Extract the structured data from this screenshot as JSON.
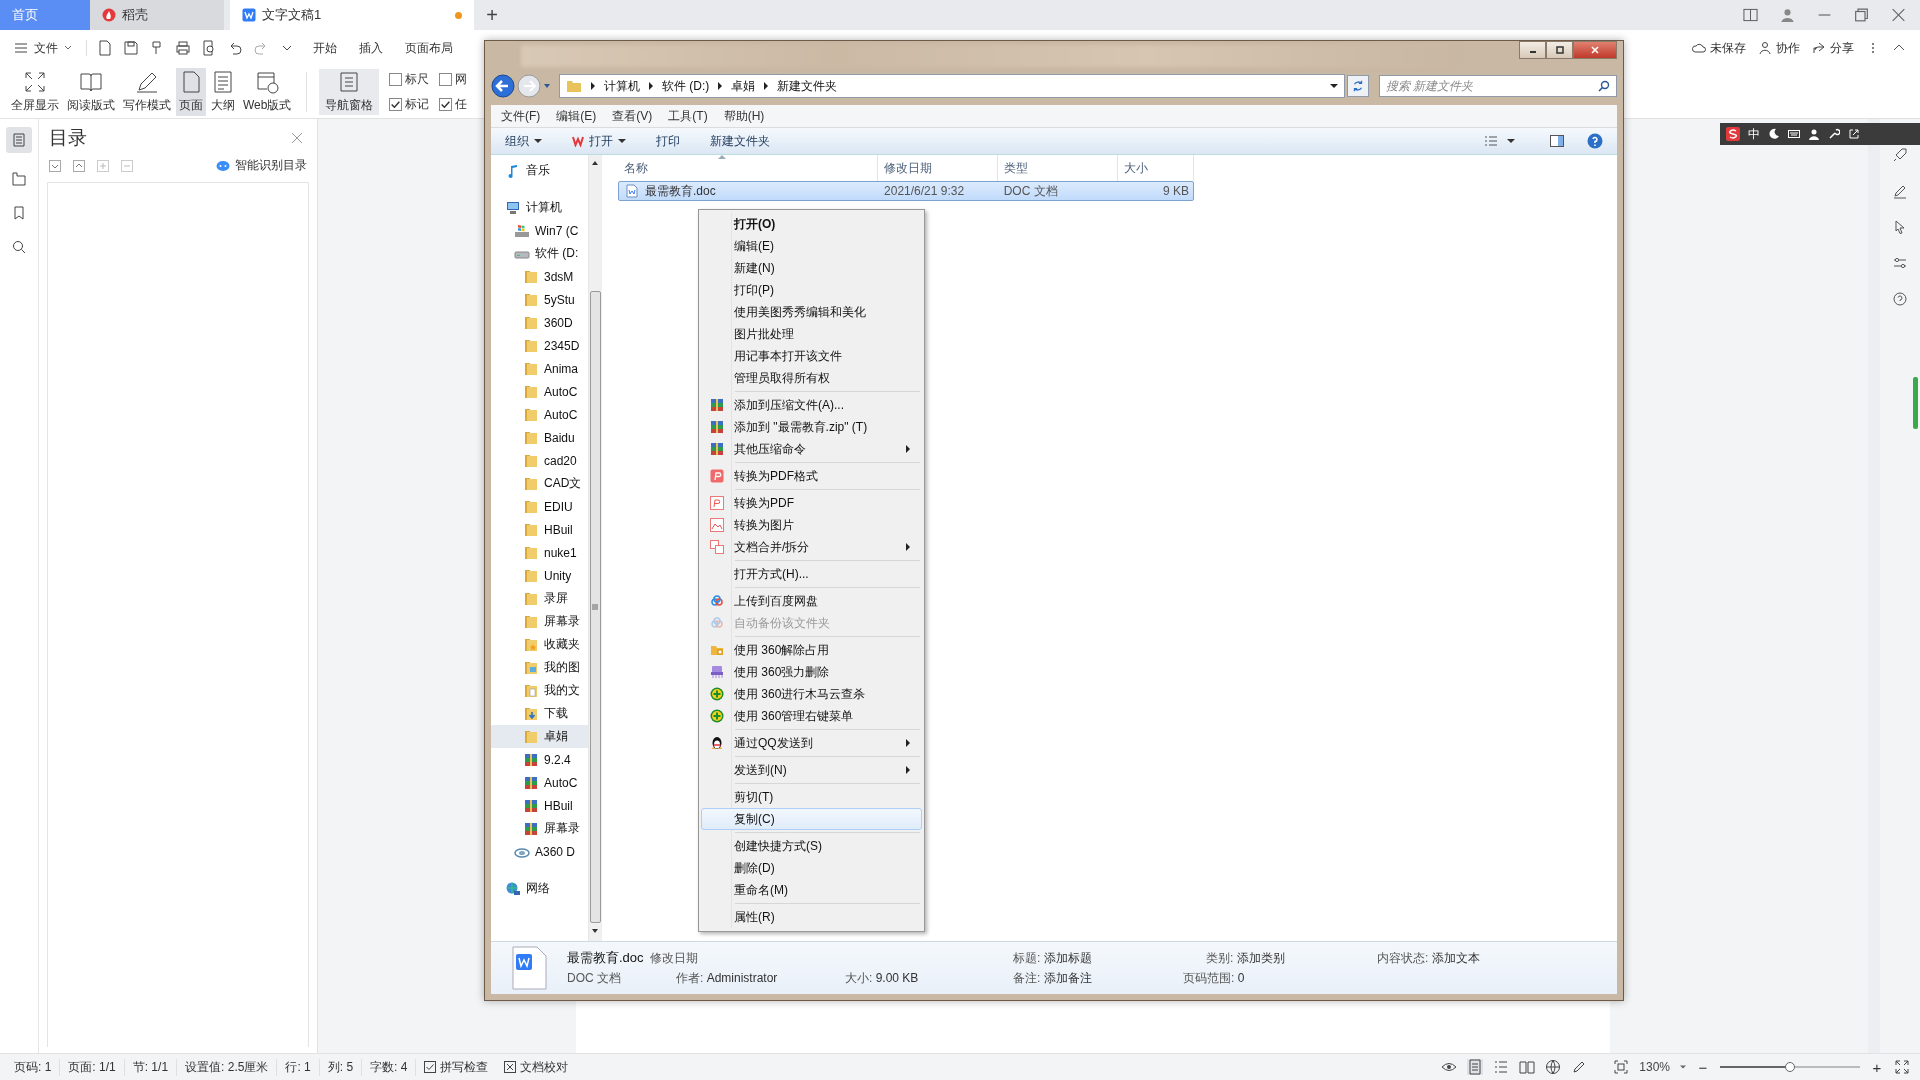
{
  "tabs": [
    {
      "label": "首页",
      "kind": "home",
      "selected": false,
      "unsaved": false
    },
    {
      "label": "稻壳",
      "kind": "docer",
      "selected": false,
      "unsaved": false
    },
    {
      "label": "文字文稿1",
      "kind": "doc",
      "selected": true,
      "unsaved": true
    }
  ],
  "new_tab": "+",
  "file_menu": "文件",
  "menu_tabs": [
    "开始",
    "插入",
    "页面布局"
  ],
  "ribbon": [
    {
      "label": "全屏显示",
      "kind": "fullscreen",
      "selected": false
    },
    {
      "label": "阅读版式",
      "kind": "read",
      "selected": false
    },
    {
      "label": "写作模式",
      "kind": "write",
      "selected": false
    },
    {
      "label": "页面",
      "kind": "page",
      "selected": true
    },
    {
      "label": "大纲",
      "kind": "outline",
      "selected": false
    },
    {
      "label": "Web版式",
      "kind": "web",
      "selected": false
    }
  ],
  "nav_pane": "导航窗格",
  "ribbon_checks": [
    {
      "label": "标尺",
      "checked": false
    },
    {
      "label": "网",
      "checked": false
    },
    {
      "label": "标记",
      "checked": true
    },
    {
      "label": "任",
      "checked": true
    }
  ],
  "top_right": [
    {
      "label": "未保存",
      "kind": "cloud"
    },
    {
      "label": "协作",
      "kind": "people"
    },
    {
      "label": "分享",
      "kind": "share"
    }
  ],
  "toc": {
    "title": "目录",
    "smart": "智能识别目录"
  },
  "ime": "中",
  "explorer": {
    "path": [
      "计算机",
      "软件 (D:)",
      "卓娟",
      "新建文件夹"
    ],
    "search_placeholder": "搜索 新建文件夹",
    "menu": [
      "文件(F)",
      "编辑(E)",
      "查看(V)",
      "工具(T)",
      "帮助(H)"
    ],
    "toolbar": [
      {
        "label": "组织",
        "caret": true,
        "kind": "plain"
      },
      {
        "label": "打开",
        "caret": true,
        "kind": "wps"
      },
      {
        "label": "打印",
        "caret": false,
        "kind": "plain"
      },
      {
        "label": "新建文件夹",
        "caret": false,
        "kind": "plain"
      }
    ],
    "tree": [
      {
        "label": "音乐",
        "kind": "music",
        "selected": false
      },
      {
        "label": "计算机",
        "kind": "computer",
        "selected": false,
        "children": [
          {
            "label": "Win7 (C",
            "kind": "windows",
            "selected": false
          },
          {
            "label": "软件 (D:",
            "kind": "drive",
            "selected": false,
            "children": [
              {
                "label": "3dsM",
                "kind": "folder",
                "selected": false
              },
              {
                "label": "5yStu",
                "kind": "folder",
                "selected": false
              },
              {
                "label": "360D",
                "kind": "folder",
                "selected": false
              },
              {
                "label": "2345D",
                "kind": "folder",
                "selected": false
              },
              {
                "label": "Anima",
                "kind": "folder",
                "selected": false
              },
              {
                "label": "AutoC",
                "kind": "folder",
                "selected": false
              },
              {
                "label": "AutoC",
                "kind": "folder",
                "selected": false
              },
              {
                "label": "Baidu",
                "kind": "folder",
                "selected": false
              },
              {
                "label": "cad20",
                "kind": "folder",
                "selected": false
              },
              {
                "label": "CAD文",
                "kind": "folder",
                "selected": false
              },
              {
                "label": "EDIU",
                "kind": "folder",
                "selected": false
              },
              {
                "label": "HBuil",
                "kind": "folder",
                "selected": false
              },
              {
                "label": "nuke1",
                "kind": "folder",
                "selected": false
              },
              {
                "label": "Unity",
                "kind": "folder",
                "selected": false
              },
              {
                "label": "录屏",
                "kind": "folder",
                "selected": false
              },
              {
                "label": "屏幕录",
                "kind": "folder",
                "selected": false
              },
              {
                "label": "收藏夹",
                "kind": "favorites",
                "selected": false
              },
              {
                "label": "我的图",
                "kind": "pictures",
                "selected": false
              },
              {
                "label": "我的文",
                "kind": "documents",
                "selected": false
              },
              {
                "label": "下载",
                "kind": "downloads",
                "selected": false
              },
              {
                "label": "卓娟",
                "kind": "folder",
                "selected": true
              },
              {
                "label": "9.2.4",
                "kind": "archive",
                "selected": false
              },
              {
                "label": "AutoC",
                "kind": "archive",
                "selected": false
              },
              {
                "label": "HBuil",
                "kind": "archive",
                "selected": false
              },
              {
                "label": "屏幕录",
                "kind": "archive",
                "selected": false
              }
            ]
          },
          {
            "label": "A360 D",
            "kind": "cloud",
            "selected": false
          }
        ]
      },
      {
        "label": "网络",
        "kind": "network",
        "selected": false
      }
    ],
    "columns": [
      "名称",
      "修改日期",
      "类型",
      "大小"
    ],
    "files": [
      {
        "name": "最需教育.doc",
        "date": "2021/6/21 9:32",
        "type": "DOC 文档",
        "size": "9 KB",
        "selected": true
      }
    ],
    "details": {
      "name": "最需教育.doc",
      "type": "DOC 文档",
      "top_row": [
        {
          "label": "修改日期"
        },
        {
          "label": "标题:",
          "value": "添加标题"
        },
        {
          "label": "类别:",
          "value": "添加类别"
        },
        {
          "label": "内容状态:",
          "value": "添加文本"
        }
      ],
      "bottom_row": [
        {
          "label": "作者:",
          "value": "Administrator"
        },
        {
          "label": "大小:",
          "value": "9.00 KB"
        },
        {
          "label": "备注:",
          "value": "添加备注"
        },
        {
          "label": "页码范围:",
          "value": "0"
        }
      ]
    }
  },
  "context_menu": [
    [
      {
        "label": "打开(O)",
        "kind": "plain",
        "default": true,
        "submenu": false,
        "disabled": false,
        "selected": false
      },
      {
        "label": "编辑(E)",
        "kind": "plain",
        "default": false,
        "submenu": false,
        "disabled": false,
        "selected": false
      },
      {
        "label": "新建(N)",
        "kind": "plain",
        "default": false,
        "submenu": false,
        "disabled": false,
        "selected": false
      },
      {
        "label": "打印(P)",
        "kind": "plain",
        "default": false,
        "submenu": false,
        "disabled": false,
        "selected": false
      },
      {
        "label": "使用美图秀秀编辑和美化",
        "kind": "plain",
        "default": false,
        "submenu": false,
        "disabled": false,
        "selected": false
      },
      {
        "label": "图片批处理",
        "kind": "plain",
        "default": false,
        "submenu": false,
        "disabled": false,
        "selected": false
      },
      {
        "label": "用记事本打开该文件",
        "kind": "plain",
        "default": false,
        "submenu": false,
        "disabled": false,
        "selected": false
      },
      {
        "label": "管理员取得所有权",
        "kind": "plain",
        "default": false,
        "submenu": false,
        "disabled": false,
        "selected": false
      }
    ],
    [
      {
        "label": "添加到压缩文件(A)...",
        "kind": "archive",
        "default": false,
        "submenu": false,
        "disabled": false,
        "selected": false
      },
      {
        "label": "添加到 \"最需教育.zip\" (T)",
        "kind": "archive",
        "default": false,
        "submenu": false,
        "disabled": false,
        "selected": false
      },
      {
        "label": "其他压缩命令",
        "kind": "archive",
        "default": false,
        "submenu": true,
        "disabled": false,
        "selected": false
      }
    ],
    [
      {
        "label": "转换为PDF格式",
        "kind": "pdf",
        "default": false,
        "submenu": false,
        "disabled": false,
        "selected": false
      }
    ],
    [
      {
        "label": "转换为PDF",
        "kind": "pdf-outline",
        "default": false,
        "submenu": false,
        "disabled": false,
        "selected": false
      },
      {
        "label": "转换为图片",
        "kind": "image",
        "default": false,
        "submenu": false,
        "disabled": false,
        "selected": false
      },
      {
        "label": "文档合并/拆分",
        "kind": "merge",
        "default": false,
        "submenu": true,
        "disabled": false,
        "selected": false
      }
    ],
    [
      {
        "label": "打开方式(H)...",
        "kind": "plain",
        "default": false,
        "submenu": false,
        "disabled": false,
        "selected": false
      }
    ],
    [
      {
        "label": "上传到百度网盘",
        "kind": "cloud",
        "default": false,
        "submenu": false,
        "disabled": false,
        "selected": false
      },
      {
        "label": "自动备份该文件夹",
        "kind": "cloud",
        "default": false,
        "submenu": false,
        "disabled": true,
        "selected": false
      }
    ],
    [
      {
        "label": "使用 360解除占用",
        "kind": "unlock",
        "default": false,
        "submenu": false,
        "disabled": false,
        "selected": false
      },
      {
        "label": "使用 360强力删除",
        "kind": "shred",
        "default": false,
        "submenu": false,
        "disabled": false,
        "selected": false
      },
      {
        "label": "使用 360进行木马云查杀",
        "kind": "plus",
        "default": false,
        "submenu": false,
        "disabled": false,
        "selected": false
      },
      {
        "label": "使用 360管理右键菜单",
        "kind": "plus",
        "default": false,
        "submenu": false,
        "disabled": false,
        "selected": false
      }
    ],
    [
      {
        "label": "通过QQ发送到",
        "kind": "penguin",
        "default": false,
        "submenu": true,
        "disabled": false,
        "selected": false
      }
    ],
    [
      {
        "label": "发送到(N)",
        "kind": "plain",
        "default": false,
        "submenu": true,
        "disabled": false,
        "selected": false
      }
    ],
    [
      {
        "label": "剪切(T)",
        "kind": "plain",
        "default": false,
        "submenu": false,
        "disabled": false,
        "selected": false
      },
      {
        "label": "复制(C)",
        "kind": "plain",
        "default": false,
        "submenu": false,
        "disabled": false,
        "selected": true
      }
    ],
    [
      {
        "label": "创建快捷方式(S)",
        "kind": "plain",
        "default": false,
        "submenu": false,
        "disabled": false,
        "selected": false
      },
      {
        "label": "删除(D)",
        "kind": "plain",
        "default": false,
        "submenu": false,
        "disabled": false,
        "selected": false
      },
      {
        "label": "重命名(M)",
        "kind": "plain",
        "default": false,
        "submenu": false,
        "disabled": false,
        "selected": false
      }
    ],
    [
      {
        "label": "属性(R)",
        "kind": "plain",
        "default": false,
        "submenu": false,
        "disabled": false,
        "selected": false
      }
    ]
  ],
  "status_bar": {
    "items": [
      "页码: 1",
      "页面: 1/1",
      "节: 1/1",
      "设置值: 2.5厘米",
      "行: 1",
      "列: 5",
      "字数: 4"
    ],
    "checks": [
      {
        "label": "拼写检查",
        "kind": "tick"
      },
      {
        "label": "文档校对",
        "kind": "cross"
      }
    ],
    "zoom": "130%",
    "zoom_out": "−",
    "zoom_in": "+",
    "level": 0.5
  }
}
